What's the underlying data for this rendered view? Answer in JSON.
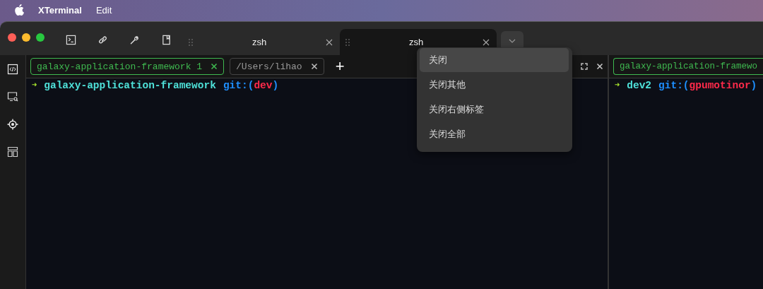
{
  "menu_bar": {
    "app_name": "XTerminal",
    "items": [
      "Edit"
    ]
  },
  "tabs": [
    {
      "label": "zsh",
      "selected": false
    },
    {
      "label": "zsh",
      "selected": true
    }
  ],
  "context_menu": {
    "items": [
      {
        "label": "关闭",
        "selected": true
      },
      {
        "label": "关闭其他",
        "selected": false
      },
      {
        "label": "关闭右侧标签",
        "selected": false
      },
      {
        "label": "关闭全部",
        "selected": false
      }
    ]
  },
  "panes": [
    {
      "tabs": [
        {
          "label": "galaxy-application-framework 1",
          "selected": true,
          "closable": true
        },
        {
          "label": "/Users/lihao",
          "selected": false,
          "closable": true
        }
      ],
      "add_button": "+",
      "controls": true,
      "prompt": {
        "arrow": "➜",
        "dir": "galaxy-application-framework",
        "git_open": "git:(",
        "branch": "dev",
        "git_close": ")"
      }
    },
    {
      "tabs": [
        {
          "label": "galaxy-application-framewo",
          "selected": true
        }
      ],
      "controls": false,
      "prompt": {
        "arrow": "➜",
        "dir": "dev2",
        "git_open": "git:(",
        "branch": "gpumotinor",
        "git_close": ")"
      }
    }
  ]
}
